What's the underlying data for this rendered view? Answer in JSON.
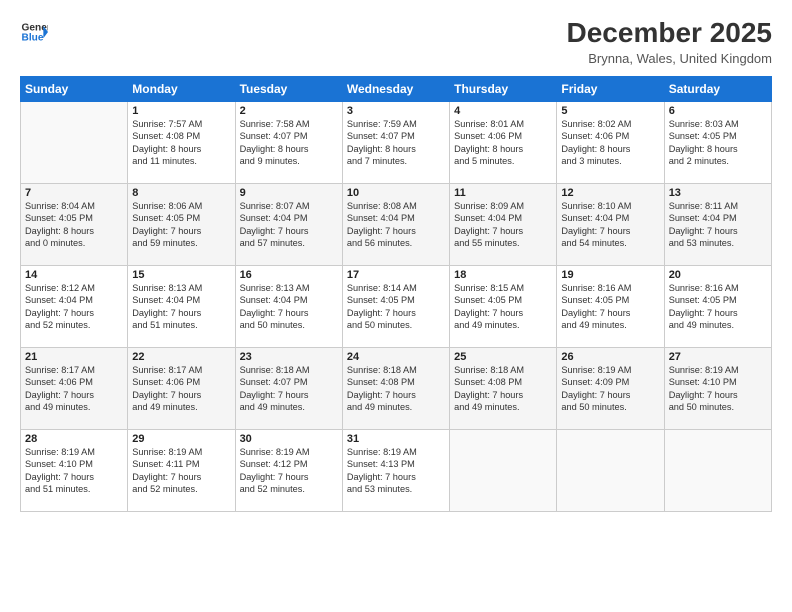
{
  "logo": {
    "line1": "General",
    "line2": "Blue",
    "arrow_color": "#1a73d4"
  },
  "title": "December 2025",
  "location": "Brynna, Wales, United Kingdom",
  "days_of_week": [
    "Sunday",
    "Monday",
    "Tuesday",
    "Wednesday",
    "Thursday",
    "Friday",
    "Saturday"
  ],
  "weeks": [
    [
      {
        "day": "",
        "info": ""
      },
      {
        "day": "1",
        "info": "Sunrise: 7:57 AM\nSunset: 4:08 PM\nDaylight: 8 hours\nand 11 minutes."
      },
      {
        "day": "2",
        "info": "Sunrise: 7:58 AM\nSunset: 4:07 PM\nDaylight: 8 hours\nand 9 minutes."
      },
      {
        "day": "3",
        "info": "Sunrise: 7:59 AM\nSunset: 4:07 PM\nDaylight: 8 hours\nand 7 minutes."
      },
      {
        "day": "4",
        "info": "Sunrise: 8:01 AM\nSunset: 4:06 PM\nDaylight: 8 hours\nand 5 minutes."
      },
      {
        "day": "5",
        "info": "Sunrise: 8:02 AM\nSunset: 4:06 PM\nDaylight: 8 hours\nand 3 minutes."
      },
      {
        "day": "6",
        "info": "Sunrise: 8:03 AM\nSunset: 4:05 PM\nDaylight: 8 hours\nand 2 minutes."
      }
    ],
    [
      {
        "day": "7",
        "info": "Sunrise: 8:04 AM\nSunset: 4:05 PM\nDaylight: 8 hours\nand 0 minutes."
      },
      {
        "day": "8",
        "info": "Sunrise: 8:06 AM\nSunset: 4:05 PM\nDaylight: 7 hours\nand 59 minutes."
      },
      {
        "day": "9",
        "info": "Sunrise: 8:07 AM\nSunset: 4:04 PM\nDaylight: 7 hours\nand 57 minutes."
      },
      {
        "day": "10",
        "info": "Sunrise: 8:08 AM\nSunset: 4:04 PM\nDaylight: 7 hours\nand 56 minutes."
      },
      {
        "day": "11",
        "info": "Sunrise: 8:09 AM\nSunset: 4:04 PM\nDaylight: 7 hours\nand 55 minutes."
      },
      {
        "day": "12",
        "info": "Sunrise: 8:10 AM\nSunset: 4:04 PM\nDaylight: 7 hours\nand 54 minutes."
      },
      {
        "day": "13",
        "info": "Sunrise: 8:11 AM\nSunset: 4:04 PM\nDaylight: 7 hours\nand 53 minutes."
      }
    ],
    [
      {
        "day": "14",
        "info": "Sunrise: 8:12 AM\nSunset: 4:04 PM\nDaylight: 7 hours\nand 52 minutes."
      },
      {
        "day": "15",
        "info": "Sunrise: 8:13 AM\nSunset: 4:04 PM\nDaylight: 7 hours\nand 51 minutes."
      },
      {
        "day": "16",
        "info": "Sunrise: 8:13 AM\nSunset: 4:04 PM\nDaylight: 7 hours\nand 50 minutes."
      },
      {
        "day": "17",
        "info": "Sunrise: 8:14 AM\nSunset: 4:05 PM\nDaylight: 7 hours\nand 50 minutes."
      },
      {
        "day": "18",
        "info": "Sunrise: 8:15 AM\nSunset: 4:05 PM\nDaylight: 7 hours\nand 49 minutes."
      },
      {
        "day": "19",
        "info": "Sunrise: 8:16 AM\nSunset: 4:05 PM\nDaylight: 7 hours\nand 49 minutes."
      },
      {
        "day": "20",
        "info": "Sunrise: 8:16 AM\nSunset: 4:05 PM\nDaylight: 7 hours\nand 49 minutes."
      }
    ],
    [
      {
        "day": "21",
        "info": "Sunrise: 8:17 AM\nSunset: 4:06 PM\nDaylight: 7 hours\nand 49 minutes."
      },
      {
        "day": "22",
        "info": "Sunrise: 8:17 AM\nSunset: 4:06 PM\nDaylight: 7 hours\nand 49 minutes."
      },
      {
        "day": "23",
        "info": "Sunrise: 8:18 AM\nSunset: 4:07 PM\nDaylight: 7 hours\nand 49 minutes."
      },
      {
        "day": "24",
        "info": "Sunrise: 8:18 AM\nSunset: 4:08 PM\nDaylight: 7 hours\nand 49 minutes."
      },
      {
        "day": "25",
        "info": "Sunrise: 8:18 AM\nSunset: 4:08 PM\nDaylight: 7 hours\nand 49 minutes."
      },
      {
        "day": "26",
        "info": "Sunrise: 8:19 AM\nSunset: 4:09 PM\nDaylight: 7 hours\nand 50 minutes."
      },
      {
        "day": "27",
        "info": "Sunrise: 8:19 AM\nSunset: 4:10 PM\nDaylight: 7 hours\nand 50 minutes."
      }
    ],
    [
      {
        "day": "28",
        "info": "Sunrise: 8:19 AM\nSunset: 4:10 PM\nDaylight: 7 hours\nand 51 minutes."
      },
      {
        "day": "29",
        "info": "Sunrise: 8:19 AM\nSunset: 4:11 PM\nDaylight: 7 hours\nand 52 minutes."
      },
      {
        "day": "30",
        "info": "Sunrise: 8:19 AM\nSunset: 4:12 PM\nDaylight: 7 hours\nand 52 minutes."
      },
      {
        "day": "31",
        "info": "Sunrise: 8:19 AM\nSunset: 4:13 PM\nDaylight: 7 hours\nand 53 minutes."
      },
      {
        "day": "",
        "info": ""
      },
      {
        "day": "",
        "info": ""
      },
      {
        "day": "",
        "info": ""
      }
    ]
  ]
}
